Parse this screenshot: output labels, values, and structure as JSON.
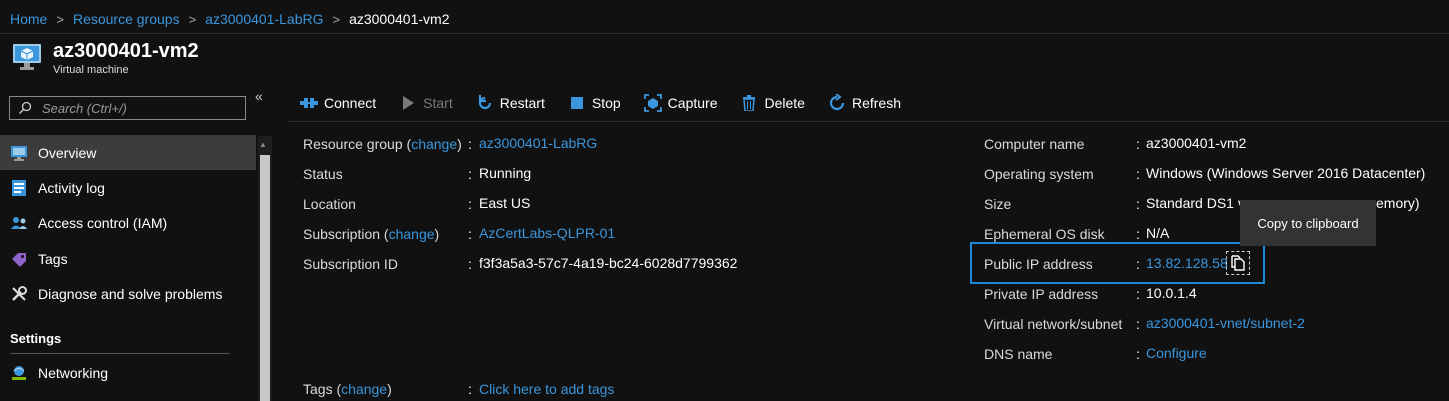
{
  "breadcrumb": {
    "items": [
      "Home",
      "Resource groups",
      "az3000401-LabRG"
    ],
    "current": "az3000401-vm2"
  },
  "header": {
    "title": "az3000401-vm2",
    "subtitle": "Virtual machine"
  },
  "sidebar": {
    "search_placeholder": "Search (Ctrl+/)",
    "collapse_glyph": "«",
    "items": [
      {
        "label": "Overview",
        "icon": "overview-icon",
        "active": true
      },
      {
        "label": "Activity log",
        "icon": "activity-log-icon"
      },
      {
        "label": "Access control (IAM)",
        "icon": "access-control-icon"
      },
      {
        "label": "Tags",
        "icon": "tag-icon"
      },
      {
        "label": "Diagnose and solve problems",
        "icon": "wrench-icon"
      }
    ],
    "section": "Settings",
    "settings_items": [
      {
        "label": "Networking",
        "icon": "networking-icon"
      }
    ]
  },
  "toolbar": {
    "connect": "Connect",
    "start": "Start",
    "restart": "Restart",
    "stop": "Stop",
    "capture": "Capture",
    "delete": "Delete",
    "refresh": "Refresh"
  },
  "essentials_left": {
    "resource_group_label": "Resource group",
    "change": "change",
    "resource_group_value": "az3000401-LabRG",
    "status_label": "Status",
    "status_value": "Running",
    "location_label": "Location",
    "location_value": "East US",
    "subscription_label": "Subscription",
    "subscription_value": "AzCertLabs-QLPR-01",
    "subscription_id_label": "Subscription ID",
    "subscription_id_value": "f3f3a5a3-57c7-4a19-bc24-6028d7799362",
    "tags_label": "Tags",
    "tags_value": "Click here to add tags"
  },
  "essentials_right": {
    "computer_name_label": "Computer name",
    "computer_name_value": "az3000401-vm2",
    "os_label": "Operating system",
    "os_value": "Windows (Windows Server 2016 Datacenter)",
    "size_label": "Size",
    "size_value_a": "Standard DS1 v",
    "size_value_b": "emory)",
    "ephemeral_label": "Ephemeral OS disk",
    "ephemeral_value": "N/A",
    "public_ip_label": "Public IP address",
    "public_ip_value": "13.82.128.58",
    "private_ip_label": "Private IP address",
    "private_ip_value": "10.0.1.4",
    "vnet_label": "Virtual network/subnet",
    "vnet_value": "az3000401-vnet/subnet-2",
    "dns_label": "DNS name",
    "dns_value": "Configure"
  },
  "tooltip": "Copy to clipboard",
  "colors": {
    "background": "#111111",
    "link": "#3a96dd",
    "highlight": "#1e8ad6",
    "active_nav": "#3c3c3c",
    "icon_blue": "#3a96dd"
  }
}
